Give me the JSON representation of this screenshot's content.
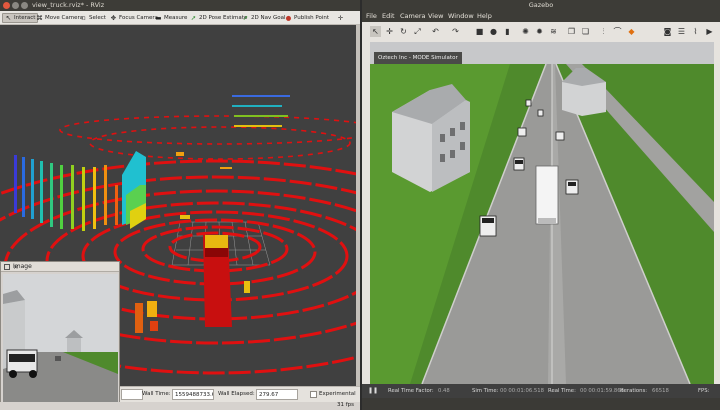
{
  "rviz": {
    "window_title": "view_truck.rviz* - RViz",
    "tools": [
      {
        "label": "Interact",
        "icon": "interact-icon",
        "glyph": "↖"
      },
      {
        "label": "Move Camera",
        "icon": "move-camera-icon",
        "glyph": "⌘"
      },
      {
        "label": "Select",
        "icon": "select-icon",
        "glyph": "▫"
      },
      {
        "label": "Focus Camera",
        "icon": "focus-camera-icon",
        "glyph": "✥"
      },
      {
        "label": "Measure",
        "icon": "measure-icon",
        "glyph": "▬"
      },
      {
        "label": "2D Pose Estimate",
        "icon": "pose-estimate-icon",
        "glyph": "➚"
      },
      {
        "label": "2D Nav Goal",
        "icon": "nav-goal-icon",
        "glyph": "➚"
      },
      {
        "label": "Publish Point",
        "icon": "publish-point-icon",
        "glyph": "●"
      }
    ],
    "add_tool_glyph": "✛",
    "image_panel_title": "Image",
    "image_panel_close": "×",
    "status": {
      "wall_time_label": "Wall Time:",
      "wall_time_value": "1559488733.69",
      "wall_elapsed_label": "Wall Elapsed:",
      "wall_elapsed_value": "279.67",
      "experimental_label": "Experimental"
    },
    "fps": "31 fps"
  },
  "gazebo": {
    "window_title": "Gazebo",
    "menu": [
      "File",
      "Edit",
      "Camera",
      "View",
      "Window",
      "Help"
    ],
    "overlay_label": "Oztech Inc - MODE Simulator",
    "status": {
      "pause_glyph": "❚❚",
      "real_time_factor_label": "Real Time Factor:",
      "real_time_factor_value": "0.48",
      "sim_time_label": "Sim Time:",
      "sim_time_value": "00 00:01:06.518",
      "real_time_label": "Real Time:",
      "real_time_value": "00 00:01:59.866",
      "iterations_label": "Iterations:",
      "iterations_value": "66518",
      "fps_label": "FPS:"
    }
  },
  "colors": {
    "lidar_ring": "#e01010",
    "truck": "#d01010",
    "grass": "#4f8a2c",
    "road": "#9a9a98"
  }
}
